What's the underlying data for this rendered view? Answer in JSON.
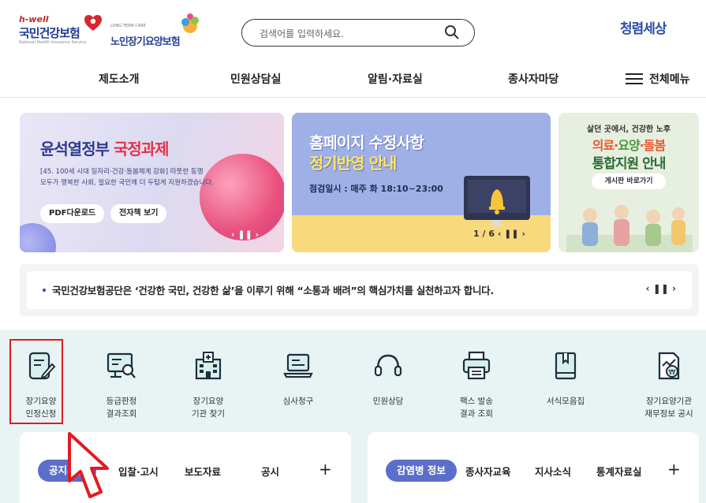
{
  "header": {
    "brand_hwell": "h-well",
    "brand_nhis": "국민건강보험",
    "brand_nhis_eng": "National Health Insurance Service",
    "brand_ltc_eng": "LONG TERM CARE",
    "brand_ltc": "노인장기요양보험",
    "search_placeholder": "검색어를 입력하세요.",
    "clean_logo": "청렴세상"
  },
  "gnb": {
    "items": [
      "제도소개",
      "민원상담실",
      "알림·자료실",
      "종사자마당"
    ],
    "menu_all": "전체메뉴"
  },
  "banners": {
    "b1": {
      "title_a": "윤석열정부 ",
      "title_b": "국정과제",
      "desc_1": "[45. 100세 시대 일자리·건강·돌봄체계 강화] 따뜻한 동행",
      "desc_2": "모두가 행복한 사회, 필요한 국민께 더 두텁게 지원하겠습니다.",
      "btn_pdf": "PDF다운로드",
      "btn_ebook": "전자책 보기",
      "ctrl": "‹  ❚❚  ›"
    },
    "b2": {
      "title_1": "홈페이지 수정사항",
      "title_2": "정기반영 안내",
      "desc": "점검일시 : 매주 화 18:10~23:00",
      "pager": "1 / 6   ‹   ❚❚   ›"
    },
    "b3": {
      "top": "살던 곳에서, 건강한 노후",
      "title_a": "의료·",
      "title_b": "요양",
      "title_c": "·돌봄",
      "title_2": "통합지원 안내",
      "btn": "게시판 바로가기"
    }
  },
  "notice": {
    "text": "국민건강보험공단은 ‘건강한 국민, 건강한 삶’을 이루기 위해 “소통과 배려”의 핵심가치를 실천하고자 합니다.",
    "ctrl": "‹  ❚❚  ›"
  },
  "quick": [
    {
      "label": "장기요양\n인정신청",
      "icon": "document-pen-icon"
    },
    {
      "label": "등급판정\n결과조회",
      "icon": "monitor-search-icon"
    },
    {
      "label": "장기요양\n기관 찾기",
      "icon": "hospital-icon"
    },
    {
      "label": "심사청구",
      "icon": "laptop-icon"
    },
    {
      "label": "민원상담",
      "icon": "headset-icon"
    },
    {
      "label": "팩스 발송\n결과 조회",
      "icon": "printer-icon"
    },
    {
      "label": "서식모음집",
      "icon": "book-icon"
    },
    {
      "label": "장기요양기관\n재무정보 공시",
      "icon": "finance-icon"
    }
  ],
  "tabs_left": {
    "active": "공지사항",
    "items": [
      "입찰·고시",
      "보도자료",
      "공시"
    ],
    "plus": "+"
  },
  "tabs_right": {
    "active": "감염병 정보",
    "items": [
      "종사자교육",
      "지사소식",
      "통계자료실"
    ],
    "plus": "+"
  },
  "colors": {
    "brand_blue": "#2a4fa8",
    "accent_red": "#e21a22",
    "tab_active": "#5c6ecb",
    "quick_bg": "#e8f4f4"
  }
}
